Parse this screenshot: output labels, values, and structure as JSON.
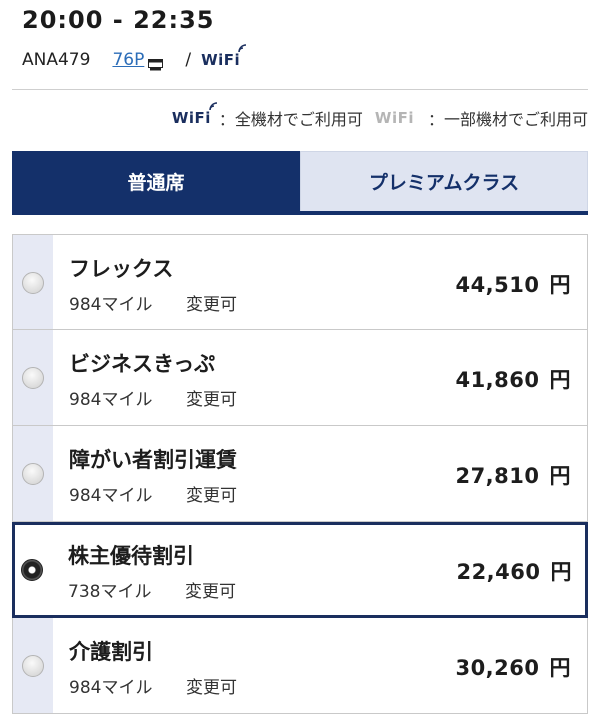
{
  "flight": {
    "time": "20:00 - 22:35",
    "number": "ANA479",
    "aircraft": "76P",
    "slash": "/",
    "wifi": "WiFi"
  },
  "legend": {
    "wifi_all": "WiFi",
    "all_text": "：全機材でご利用可",
    "wifi_some": "WiFi",
    "some_text": "：一部機材でご利用可"
  },
  "tabs": [
    {
      "label": "普通席",
      "active": true
    },
    {
      "label": "プレミアムクラス",
      "active": false
    }
  ],
  "fares": [
    {
      "name": "フレックス",
      "miles": "984マイル",
      "change": "変更可",
      "price": "44,510",
      "currency": "円",
      "selected": false
    },
    {
      "name": "ビジネスきっぷ",
      "miles": "984マイル",
      "change": "変更可",
      "price": "41,860",
      "currency": "円",
      "selected": false
    },
    {
      "name": "障がい者割引運賃",
      "miles": "984マイル",
      "change": "変更可",
      "price": "27,810",
      "currency": "円",
      "selected": false
    },
    {
      "name": "株主優待割引",
      "miles": "738マイル",
      "change": "変更可",
      "price": "22,460",
      "currency": "円",
      "selected": true
    },
    {
      "name": "介護割引",
      "miles": "984マイル",
      "change": "変更可",
      "price": "30,260",
      "currency": "円",
      "selected": false
    }
  ],
  "colors": {
    "brand_navy": "#14306a",
    "tab_inactive_bg": "#dfe4f1",
    "link_blue": "#2c6db8",
    "wifi_unavailable": "#b5b5b5"
  }
}
